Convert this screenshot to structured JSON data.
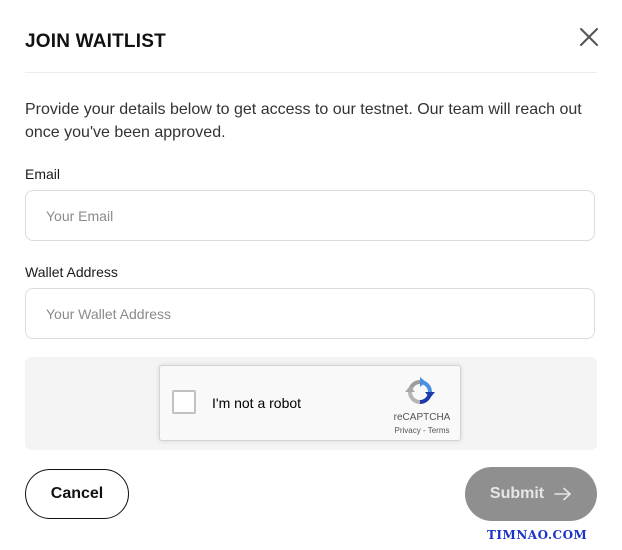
{
  "dialog": {
    "title": "JOIN WAITLIST",
    "description": "Provide your details below to get access to our testnet. Our team will reach out once you've been approved."
  },
  "form": {
    "email": {
      "label": "Email",
      "placeholder": "Your Email",
      "value": ""
    },
    "wallet": {
      "label": "Wallet Address",
      "placeholder": "Your Wallet Address",
      "value": ""
    }
  },
  "recaptcha": {
    "label": "I'm not a robot",
    "brand": "reCAPTCHA",
    "links": "Privacy - Terms",
    "checked": false
  },
  "actions": {
    "cancel_label": "Cancel",
    "submit_label": "Submit"
  },
  "watermark": "TIMNAO.COM",
  "colors": {
    "submit_bg": "#8f8f8f",
    "captcha_area_bg": "#f4f4f5",
    "watermark": "#1c34c8"
  },
  "icons": {
    "close": "close-icon",
    "submit_arrow": "arrow-right-icon",
    "recaptcha_logo": "recaptcha-logo-icon"
  }
}
